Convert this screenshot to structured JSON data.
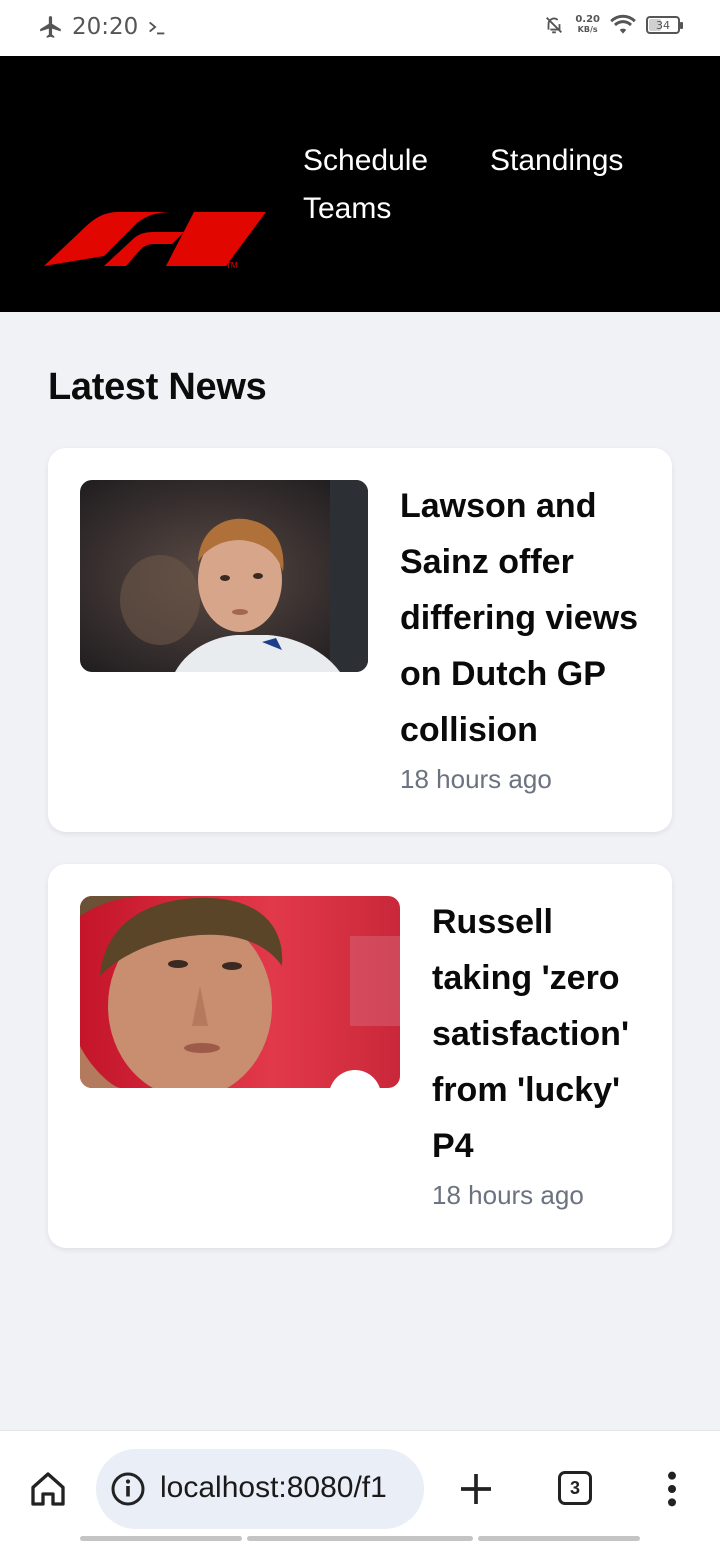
{
  "status_bar": {
    "time": "20:20",
    "net_speed_value": "0.20",
    "net_speed_unit": "KB/s",
    "battery": "34",
    "icons": [
      "airplane-icon",
      "terminal-icon",
      "dnd-icon",
      "wifi-icon",
      "battery-icon"
    ]
  },
  "header": {
    "logo_alt": "F1",
    "nav": [
      {
        "label": "Schedule"
      },
      {
        "label": "Standings"
      },
      {
        "label": "Teams"
      }
    ]
  },
  "main": {
    "section_title": "Latest News",
    "articles": [
      {
        "title": "Lawson and Sainz offer differing views on Dutch GP collision",
        "time": "18 hours ago"
      },
      {
        "title": "Russell taking 'zero satisfaction' from 'lucky' P4",
        "time": "18 hours ago"
      }
    ]
  },
  "browser": {
    "url": "localhost:8080/f1",
    "tab_count": "3"
  },
  "colors": {
    "header_bg": "#000000",
    "brand_red": "#e10600",
    "page_bg": "#f1f2f5",
    "card_bg": "#ffffff",
    "muted_text": "#6b7280"
  }
}
